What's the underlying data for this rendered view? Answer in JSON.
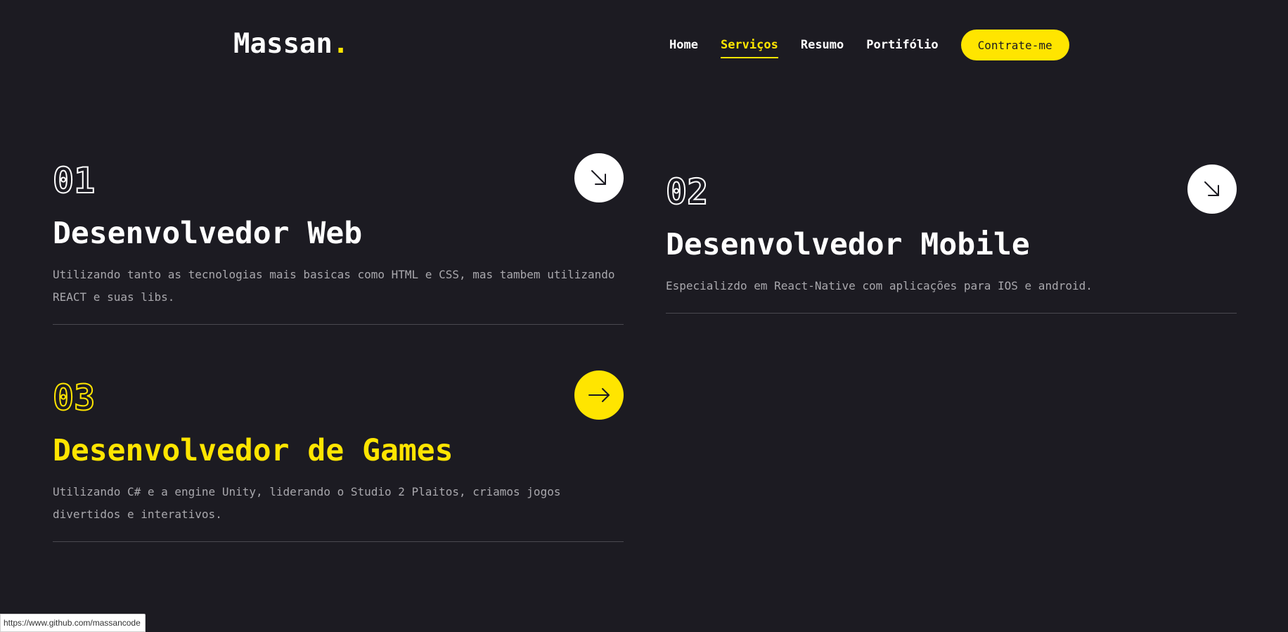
{
  "header": {
    "logo_text": "Massan",
    "logo_dot": ".",
    "nav": [
      {
        "label": "Home"
      },
      {
        "label": "Serviços"
      },
      {
        "label": "Resumo"
      },
      {
        "label": "Portifólio"
      }
    ],
    "hire_button": "Contrate-me"
  },
  "services": [
    {
      "number": "01",
      "title": "Desenvolvedor Web",
      "description": "Utilizando tanto as tecnologias mais basicas como HTML e CSS, mas tambem utilizando REACT e suas libs.",
      "arrow_icon": "arrow-down-right-icon"
    },
    {
      "number": "02",
      "title": "Desenvolvedor Mobile",
      "description": "Especializdo em React-Native com aplicações para IOS e android.",
      "arrow_icon": "arrow-down-right-icon"
    },
    {
      "number": "03",
      "title": "Desenvolvedor de Games",
      "description": "Utilizando C# e a engine Unity, liderando o Studio 2 Plaitos, criamos jogos divertidos e interativos.",
      "arrow_icon": "arrow-right-icon"
    }
  ],
  "status_bar": {
    "url": "https://www.github.com/massancode"
  },
  "colors": {
    "background": "#1c1b22",
    "accent": "#ffe500",
    "text": "#ffffff",
    "muted_text": "#a9a8ad"
  }
}
